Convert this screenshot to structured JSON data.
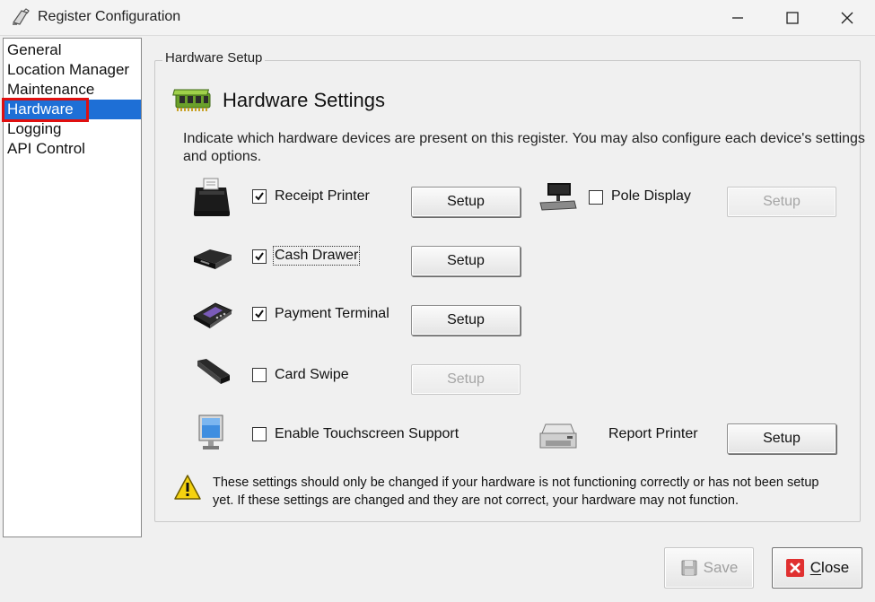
{
  "window": {
    "title": "Register Configuration"
  },
  "sidebar": {
    "items": [
      {
        "label": "General"
      },
      {
        "label": "Location Manager"
      },
      {
        "label": "Maintenance"
      },
      {
        "label": "Hardware",
        "selected": true
      },
      {
        "label": "Logging"
      },
      {
        "label": "API Control"
      }
    ]
  },
  "main": {
    "group_label": "Hardware Setup",
    "section_title": "Hardware Settings",
    "description": "Indicate which hardware devices are present on this register.  You may also configure each device's settings and options.",
    "devices": [
      {
        "icon": "receipt-printer-icon",
        "label": "Receipt Printer",
        "checked": true,
        "button": "Setup",
        "button_enabled": true
      },
      {
        "icon": "cash-drawer-icon",
        "label": "Cash Drawer",
        "checked": true,
        "button": "Setup",
        "button_enabled": true
      },
      {
        "icon": "payment-terminal-icon",
        "label": "Payment Terminal",
        "checked": true,
        "button": "Setup",
        "button_enabled": true
      },
      {
        "icon": "card-swipe-icon",
        "label": "Card Swipe",
        "checked": false,
        "button": "Setup",
        "button_enabled": false
      },
      {
        "icon": "monitor-icon",
        "label": "Enable Touchscreen Support",
        "checked": false
      },
      {
        "icon": "pole-display-icon",
        "label": "Pole Display",
        "checked": false,
        "button": "Setup",
        "button_enabled": false
      },
      {
        "icon": "report-printer-icon",
        "label": "Report Printer",
        "button": "Setup",
        "button_enabled": true
      }
    ],
    "warning": "These settings should only be changed if your hardware is not functioning correctly or has not been setup yet.  If these settings are changed and they are not correct, your hardware may not function."
  },
  "footer": {
    "save_label": "Save",
    "save_enabled": false,
    "close_label": "Close"
  },
  "colors": {
    "selection": "#1e6fd6",
    "highlight_box": "#e01010",
    "close_icon": "#e03030"
  }
}
